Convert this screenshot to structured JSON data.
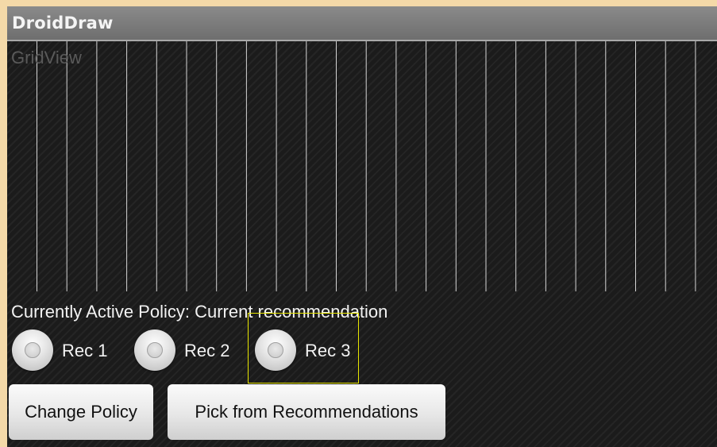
{
  "window": {
    "title": "DroidDraw"
  },
  "gridview": {
    "label": "GridView"
  },
  "policy": {
    "text": "Currently Active Policy: Current recommendation"
  },
  "radio_group": {
    "options": [
      {
        "label": "Rec 1",
        "selected": false
      },
      {
        "label": "Rec 2",
        "selected": false
      },
      {
        "label": "Rec 3",
        "selected": false
      }
    ]
  },
  "buttons": {
    "change_policy": "Change Policy",
    "pick_recommendations": "Pick from Recommendations"
  },
  "colors": {
    "page_background": "#f4d9a8",
    "screen_background": "#1b1b1b",
    "titlebar": "#7a7a7a",
    "selection_highlight": "#e8e600"
  }
}
